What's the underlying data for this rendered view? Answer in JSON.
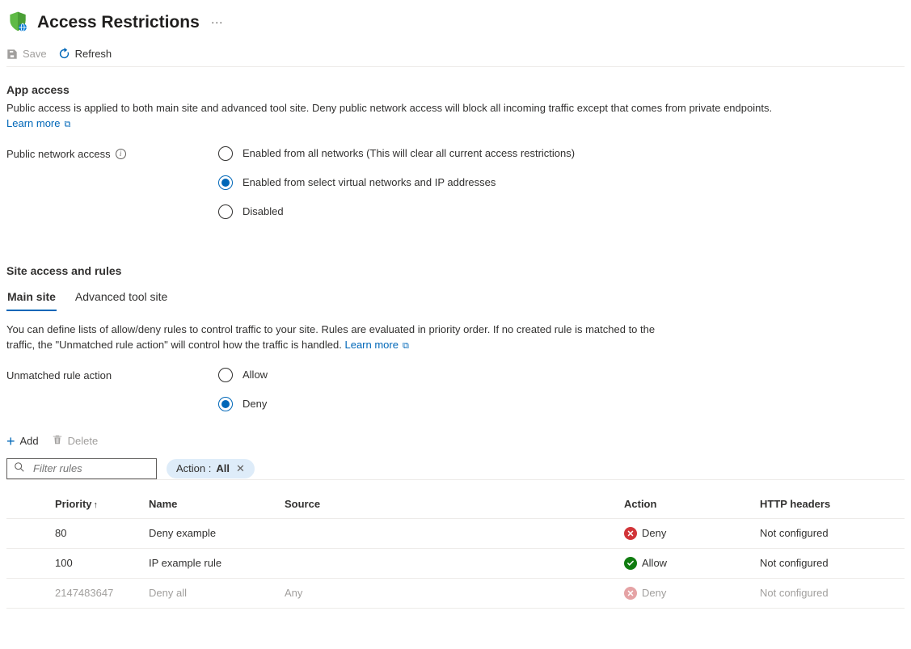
{
  "header": {
    "title": "Access Restrictions"
  },
  "toolbar": {
    "save_label": "Save",
    "refresh_label": "Refresh"
  },
  "app_access": {
    "section_title": "App access",
    "description": "Public access is applied to both main site and advanced tool site. Deny public network access will block all incoming traffic except that comes from private endpoints.",
    "learn_more": "Learn more",
    "public_label": "Public network access",
    "options": [
      {
        "label": "Enabled from all networks (This will clear all current access restrictions)",
        "selected": false
      },
      {
        "label": "Enabled from select virtual networks and IP addresses",
        "selected": true
      },
      {
        "label": "Disabled",
        "selected": false
      }
    ]
  },
  "site_rules": {
    "section_title": "Site access and rules",
    "tabs": [
      {
        "label": "Main site",
        "active": true
      },
      {
        "label": "Advanced tool site",
        "active": false
      }
    ],
    "description": "You can define lists of allow/deny rules to control traffic to your site. Rules are evaluated in priority order. If no created rule is matched to the traffic, the \"Unmatched rule action\" will control how the traffic is handled.",
    "learn_more": "Learn more",
    "unmatched_label": "Unmatched rule action",
    "unmatched_options": [
      {
        "label": "Allow",
        "selected": false
      },
      {
        "label": "Deny",
        "selected": true
      }
    ],
    "actions": {
      "add_label": "Add",
      "delete_label": "Delete"
    },
    "filter": {
      "placeholder": "Filter rules",
      "pill_key": "Action : ",
      "pill_value": "All"
    },
    "table": {
      "headers": {
        "priority": "Priority",
        "name": "Name",
        "source": "Source",
        "action": "Action",
        "http": "HTTP headers"
      },
      "rows": [
        {
          "priority": "80",
          "name": "Deny example",
          "source": "",
          "action": "Deny",
          "action_kind": "deny",
          "http": "Not configured",
          "muted": false
        },
        {
          "priority": "100",
          "name": "IP example rule",
          "source": "",
          "action": "Allow",
          "action_kind": "allow",
          "http": "Not configured",
          "muted": false
        },
        {
          "priority": "2147483647",
          "name": "Deny all",
          "source": "Any",
          "action": "Deny",
          "action_kind": "deny",
          "http": "Not configured",
          "muted": true
        }
      ]
    }
  }
}
